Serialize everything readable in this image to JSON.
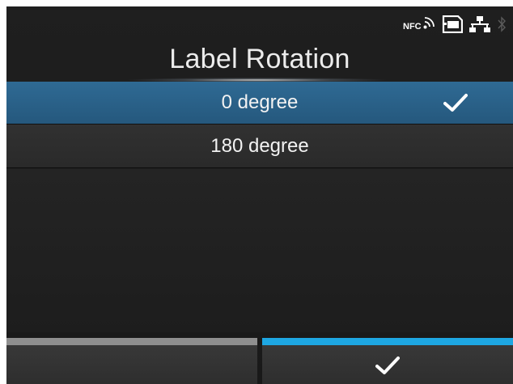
{
  "status_bar": {
    "nfc_label": "NFC",
    "icons": [
      "nfc-icon",
      "sd-card-icon",
      "network-icon",
      "bluetooth-icon"
    ]
  },
  "screen": {
    "title": "Label Rotation"
  },
  "options": [
    {
      "label": "0 degree",
      "selected": true
    },
    {
      "label": "180 degree",
      "selected": false
    }
  ],
  "softkeys": {
    "left": {
      "indicator_color": "#8f8f8f"
    },
    "right": {
      "icon": "checkmark-icon",
      "indicator_color": "#1ea7e3"
    }
  },
  "colors": {
    "selected_row": "#2a6289",
    "accent": "#1ea7e3"
  }
}
